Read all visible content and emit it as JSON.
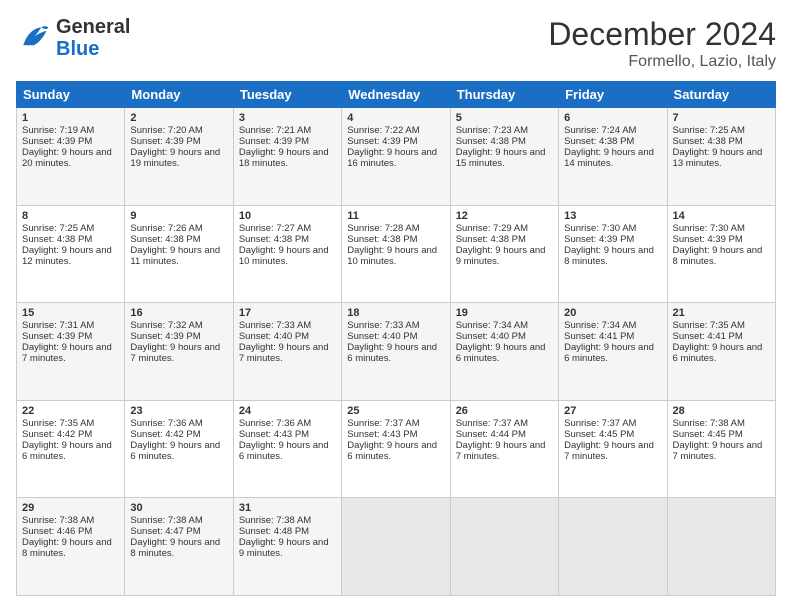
{
  "header": {
    "logo_general": "General",
    "logo_blue": "Blue",
    "title": "December 2024",
    "subtitle": "Formello, Lazio, Italy"
  },
  "days_of_week": [
    "Sunday",
    "Monday",
    "Tuesday",
    "Wednesday",
    "Thursday",
    "Friday",
    "Saturday"
  ],
  "weeks": [
    [
      {
        "day": "1",
        "sunrise": "7:19 AM",
        "sunset": "4:39 PM",
        "daylight": "9 hours and 20 minutes."
      },
      {
        "day": "2",
        "sunrise": "7:20 AM",
        "sunset": "4:39 PM",
        "daylight": "9 hours and 19 minutes."
      },
      {
        "day": "3",
        "sunrise": "7:21 AM",
        "sunset": "4:39 PM",
        "daylight": "9 hours and 18 minutes."
      },
      {
        "day": "4",
        "sunrise": "7:22 AM",
        "sunset": "4:39 PM",
        "daylight": "9 hours and 16 minutes."
      },
      {
        "day": "5",
        "sunrise": "7:23 AM",
        "sunset": "4:38 PM",
        "daylight": "9 hours and 15 minutes."
      },
      {
        "day": "6",
        "sunrise": "7:24 AM",
        "sunset": "4:38 PM",
        "daylight": "9 hours and 14 minutes."
      },
      {
        "day": "7",
        "sunrise": "7:25 AM",
        "sunset": "4:38 PM",
        "daylight": "9 hours and 13 minutes."
      }
    ],
    [
      {
        "day": "8",
        "sunrise": "7:25 AM",
        "sunset": "4:38 PM",
        "daylight": "9 hours and 12 minutes."
      },
      {
        "day": "9",
        "sunrise": "7:26 AM",
        "sunset": "4:38 PM",
        "daylight": "9 hours and 11 minutes."
      },
      {
        "day": "10",
        "sunrise": "7:27 AM",
        "sunset": "4:38 PM",
        "daylight": "9 hours and 10 minutes."
      },
      {
        "day": "11",
        "sunrise": "7:28 AM",
        "sunset": "4:38 PM",
        "daylight": "9 hours and 10 minutes."
      },
      {
        "day": "12",
        "sunrise": "7:29 AM",
        "sunset": "4:38 PM",
        "daylight": "9 hours and 9 minutes."
      },
      {
        "day": "13",
        "sunrise": "7:30 AM",
        "sunset": "4:39 PM",
        "daylight": "9 hours and 8 minutes."
      },
      {
        "day": "14",
        "sunrise": "7:30 AM",
        "sunset": "4:39 PM",
        "daylight": "9 hours and 8 minutes."
      }
    ],
    [
      {
        "day": "15",
        "sunrise": "7:31 AM",
        "sunset": "4:39 PM",
        "daylight": "9 hours and 7 minutes."
      },
      {
        "day": "16",
        "sunrise": "7:32 AM",
        "sunset": "4:39 PM",
        "daylight": "9 hours and 7 minutes."
      },
      {
        "day": "17",
        "sunrise": "7:33 AM",
        "sunset": "4:40 PM",
        "daylight": "9 hours and 7 minutes."
      },
      {
        "day": "18",
        "sunrise": "7:33 AM",
        "sunset": "4:40 PM",
        "daylight": "9 hours and 6 minutes."
      },
      {
        "day": "19",
        "sunrise": "7:34 AM",
        "sunset": "4:40 PM",
        "daylight": "9 hours and 6 minutes."
      },
      {
        "day": "20",
        "sunrise": "7:34 AM",
        "sunset": "4:41 PM",
        "daylight": "9 hours and 6 minutes."
      },
      {
        "day": "21",
        "sunrise": "7:35 AM",
        "sunset": "4:41 PM",
        "daylight": "9 hours and 6 minutes."
      }
    ],
    [
      {
        "day": "22",
        "sunrise": "7:35 AM",
        "sunset": "4:42 PM",
        "daylight": "9 hours and 6 minutes."
      },
      {
        "day": "23",
        "sunrise": "7:36 AM",
        "sunset": "4:42 PM",
        "daylight": "9 hours and 6 minutes."
      },
      {
        "day": "24",
        "sunrise": "7:36 AM",
        "sunset": "4:43 PM",
        "daylight": "9 hours and 6 minutes."
      },
      {
        "day": "25",
        "sunrise": "7:37 AM",
        "sunset": "4:43 PM",
        "daylight": "9 hours and 6 minutes."
      },
      {
        "day": "26",
        "sunrise": "7:37 AM",
        "sunset": "4:44 PM",
        "daylight": "9 hours and 7 minutes."
      },
      {
        "day": "27",
        "sunrise": "7:37 AM",
        "sunset": "4:45 PM",
        "daylight": "9 hours and 7 minutes."
      },
      {
        "day": "28",
        "sunrise": "7:38 AM",
        "sunset": "4:45 PM",
        "daylight": "9 hours and 7 minutes."
      }
    ],
    [
      {
        "day": "29",
        "sunrise": "7:38 AM",
        "sunset": "4:46 PM",
        "daylight": "9 hours and 8 minutes."
      },
      {
        "day": "30",
        "sunrise": "7:38 AM",
        "sunset": "4:47 PM",
        "daylight": "9 hours and 8 minutes."
      },
      {
        "day": "31",
        "sunrise": "7:38 AM",
        "sunset": "4:48 PM",
        "daylight": "9 hours and 9 minutes."
      },
      null,
      null,
      null,
      null
    ]
  ]
}
